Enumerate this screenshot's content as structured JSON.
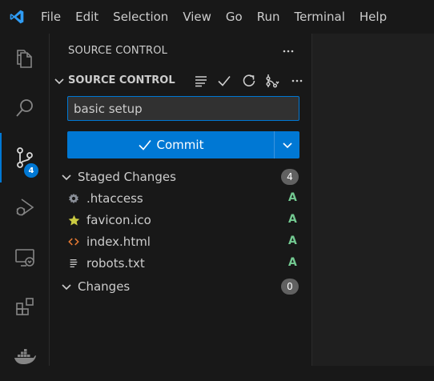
{
  "menu": [
    "File",
    "Edit",
    "Selection",
    "View",
    "Go",
    "Run",
    "Terminal",
    "Help"
  ],
  "activity_bar": {
    "source_control_badge": "4",
    "icons": [
      "explorer-icon",
      "search-icon",
      "source-control-icon",
      "run-debug-icon",
      "remote-explorer-icon",
      "extensions-icon",
      "docker-icon"
    ]
  },
  "sidebar": {
    "panel_title": "SOURCE CONTROL",
    "section_title": "SOURCE CONTROL",
    "commit_message": "basic setup",
    "commit_label": "Commit",
    "staged": {
      "label": "Staged Changes",
      "count": "4",
      "files": [
        {
          "name": ".htaccess",
          "status": "A",
          "icon": "gear-file-icon"
        },
        {
          "name": "favicon.ico",
          "status": "A",
          "icon": "star-file-icon"
        },
        {
          "name": "index.html",
          "status": "A",
          "icon": "html-file-icon"
        },
        {
          "name": "robots.txt",
          "status": "A",
          "icon": "text-file-icon"
        }
      ]
    },
    "changes": {
      "label": "Changes",
      "count": "0"
    }
  },
  "colors": {
    "accent": "#0078d4",
    "added": "#73c991",
    "background": "#181818"
  }
}
